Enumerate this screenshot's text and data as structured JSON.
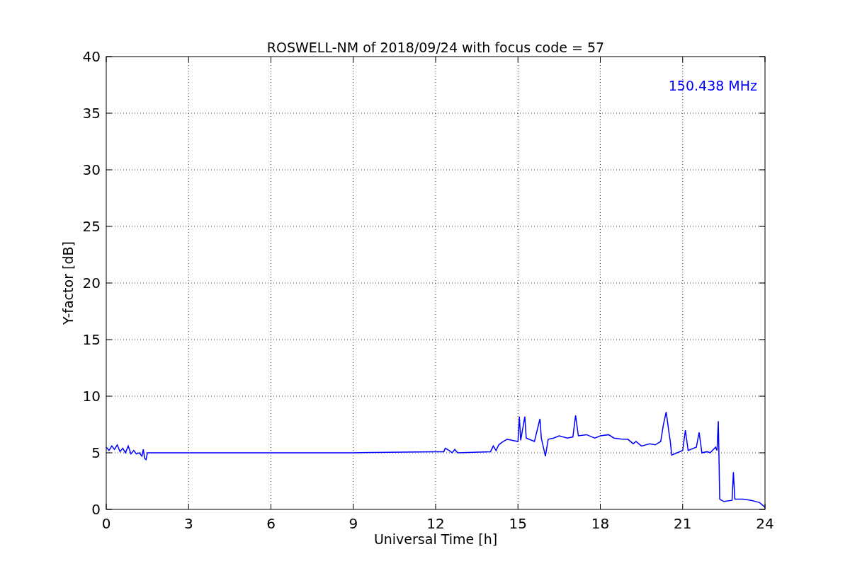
{
  "figure": {
    "chart_data": {
      "type": "line",
      "title": "ROSWELL-NM of 2018/09/24 with focus code = 57",
      "xlabel": "Universal Time [h]",
      "ylabel": "Y-factor [dB]",
      "xlim": [
        0,
        24
      ],
      "ylim": [
        0,
        40
      ],
      "xticks": [
        0,
        3,
        6,
        9,
        12,
        15,
        18,
        21,
        24
      ],
      "yticks": [
        0,
        5,
        10,
        15,
        20,
        25,
        30,
        35,
        40
      ],
      "x": [
        0,
        0.1,
        0.2,
        0.3,
        0.4,
        0.5,
        0.6,
        0.7,
        0.8,
        0.9,
        1.0,
        1.1,
        1.2,
        1.3,
        1.35,
        1.4,
        1.45,
        1.5,
        3,
        6,
        9,
        12,
        12.3,
        12.35,
        12.5,
        12.6,
        12.7,
        12.8,
        14,
        14.1,
        14.2,
        14.3,
        14.4,
        14.6,
        14.8,
        15,
        15.05,
        15.1,
        15.25,
        15.3,
        15.4,
        15.6,
        15.8,
        15.85,
        16,
        16.1,
        16.3,
        16.5,
        16.8,
        17,
        17.1,
        17.2,
        17.5,
        17.8,
        18,
        18.3,
        18.5,
        18.8,
        19,
        19.2,
        19.3,
        19.5,
        19.8,
        20,
        20.2,
        20.3,
        20.4,
        20.5,
        20.55,
        20.6,
        20.8,
        21,
        21.1,
        21.2,
        21.5,
        21.6,
        21.7,
        21.9,
        22,
        22.2,
        22.25,
        22.3,
        22.35,
        22.5,
        22.8,
        22.85,
        22.9,
        23.2,
        23.5,
        23.8,
        24
      ],
      "series": [
        {
          "name": "150.438 MHz",
          "color": "#0000ff",
          "values": [
            5.5,
            5.2,
            5.6,
            5.3,
            5.7,
            5.1,
            5.4,
            5.0,
            5.6,
            4.9,
            5.2,
            4.9,
            5.0,
            4.7,
            5.3,
            4.5,
            4.4,
            5.0,
            5.0,
            5.0,
            5.0,
            5.1,
            5.1,
            5.4,
            5.2,
            5.0,
            5.3,
            5.0,
            5.1,
            5.6,
            5.2,
            5.7,
            5.9,
            6.2,
            6.1,
            6.0,
            8.2,
            6.1,
            8.2,
            6.3,
            6.2,
            6.0,
            8.0,
            6.3,
            4.7,
            6.2,
            6.3,
            6.5,
            6.3,
            6.4,
            8.3,
            6.5,
            6.6,
            6.3,
            6.5,
            6.6,
            6.3,
            6.2,
            6.2,
            5.8,
            6.0,
            5.6,
            5.8,
            5.7,
            6.0,
            7.5,
            8.6,
            6.8,
            6.0,
            4.8,
            5.0,
            5.2,
            7.0,
            5.2,
            5.5,
            6.8,
            5.0,
            5.1,
            5.0,
            5.5,
            5.2,
            7.8,
            0.9,
            0.7,
            0.8,
            3.3,
            0.9,
            0.9,
            0.8,
            0.6,
            0.2
          ]
        }
      ],
      "grid": true
    }
  }
}
